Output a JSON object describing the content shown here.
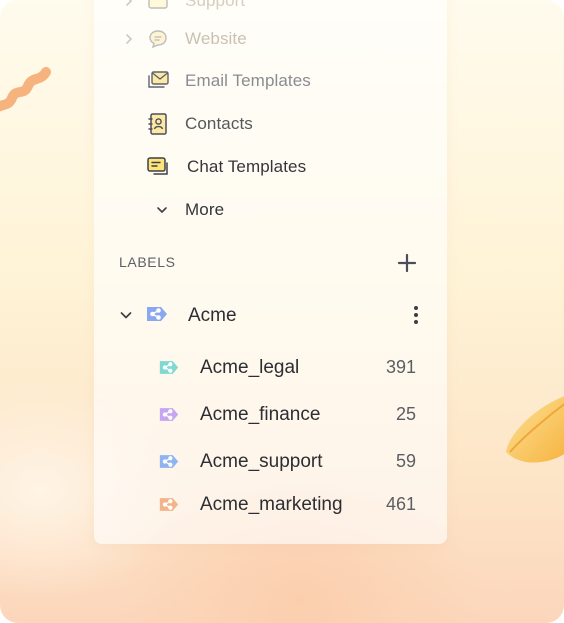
{
  "nav": {
    "items": [
      {
        "label": "Support",
        "icon": "support-icon",
        "state": "cut-off"
      },
      {
        "label": "Website",
        "icon": "chat-bubble-icon",
        "state": "faded"
      },
      {
        "label": "Email Templates",
        "icon": "email-templates-icon"
      },
      {
        "label": "Contacts",
        "icon": "contacts-icon"
      },
      {
        "label": "Chat Templates",
        "icon": "chat-templates-icon"
      },
      {
        "label": "More",
        "icon": "chevron-down-icon"
      }
    ]
  },
  "labels": {
    "title": "LABELS",
    "add_icon": "plus-icon",
    "group": {
      "name": "Acme",
      "color": "#8aa8f0",
      "menu_icon": "more-vertical-icon",
      "items": [
        {
          "name": "Acme_legal",
          "count": "391",
          "color": "#7fd8d2"
        },
        {
          "name": "Acme_finance",
          "count": "25",
          "color": "#c6a6f2"
        },
        {
          "name": "Acme_support",
          "count": "59",
          "color": "#8fb4f2"
        },
        {
          "name": "Acme_marketing",
          "count": "461",
          "color": "#f2b48a"
        }
      ]
    }
  },
  "colors": {
    "text": "#2c2e33",
    "muted": "#c9c2b4",
    "background_top": "#fffbed",
    "background_bottom": "#fcd6bb",
    "accent_squiggle": "#f6b37e",
    "accent_leaf": "#f8c247"
  }
}
